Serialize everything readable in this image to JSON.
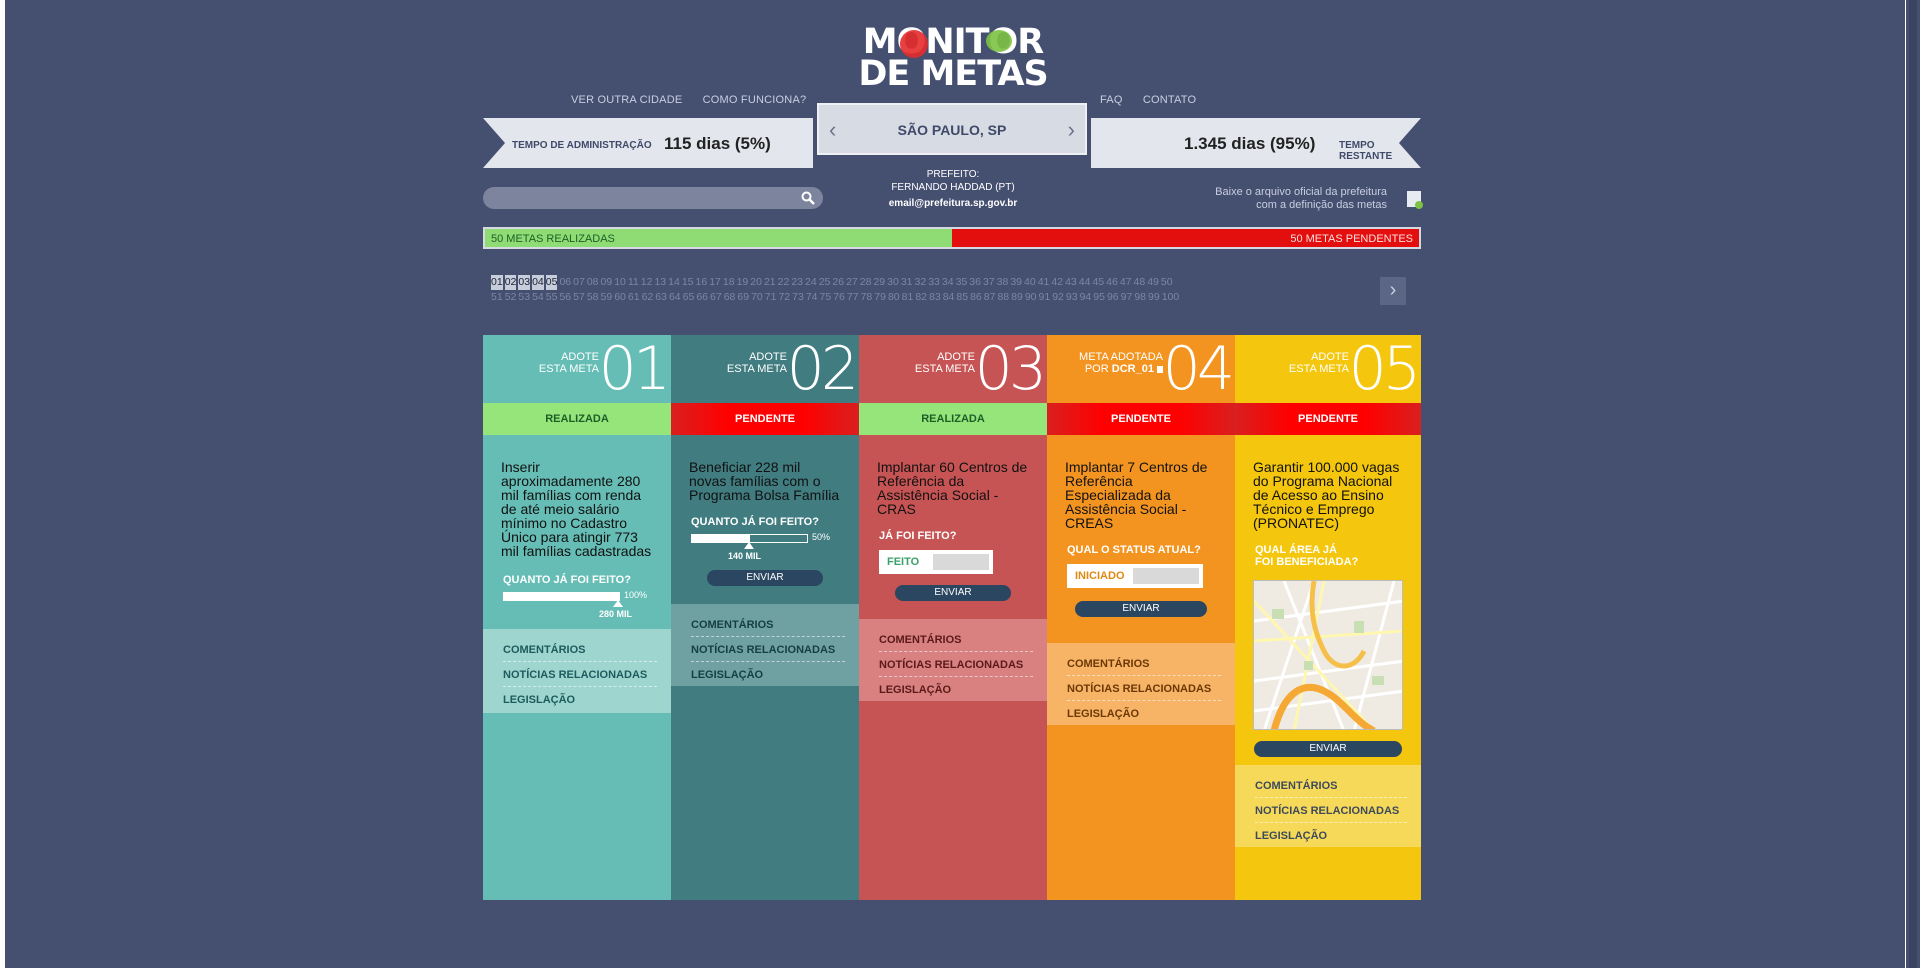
{
  "logo": {
    "line1": "MONITOR",
    "line2": "DE METAS"
  },
  "nav": {
    "left": [
      "VER OUTRA CIDADE",
      "COMO FUNCIONA?"
    ],
    "right": [
      "FAQ",
      "CONTATO"
    ]
  },
  "admin": {
    "label": "TEMPO DE ADMINISTRAÇÃO",
    "value": "115 dias (5%)"
  },
  "remaining": {
    "label": "TEMPO RESTANTE",
    "value": "1.345 dias (95%)"
  },
  "city": {
    "name": "SÃO PAULO, SP"
  },
  "mayor": {
    "label": "PREFEITO:",
    "name": "FERNANDO HADDAD (PT)",
    "email": "email@prefeitura.sp.gov.br"
  },
  "download": {
    "line1": "Baixe o arquivo oficial da prefeitura",
    "line2": "com a definição das metas"
  },
  "progress": {
    "done_label": "50 METAS REALIZADAS",
    "pending_label": "50 METAS PENDENTES",
    "done_fraction": 0.5
  },
  "numbers": {
    "row1": [
      "01",
      "02",
      "03",
      "04",
      "05",
      "06",
      "07",
      "08",
      "09",
      "10",
      "11",
      "12",
      "13",
      "14",
      "15",
      "16",
      "17",
      "18",
      "19",
      "20",
      "21",
      "22",
      "23",
      "24",
      "25",
      "26",
      "27",
      "28",
      "29",
      "30",
      "31",
      "32",
      "33",
      "34",
      "35",
      "36",
      "37",
      "38",
      "39",
      "40",
      "41",
      "42",
      "43",
      "44",
      "45",
      "46",
      "47",
      "48",
      "49",
      "50"
    ],
    "row2": [
      "51",
      "52",
      "53",
      "54",
      "55",
      "56",
      "57",
      "58",
      "59",
      "60",
      "61",
      "62",
      "63",
      "64",
      "65",
      "66",
      "67",
      "68",
      "69",
      "70",
      "71",
      "72",
      "73",
      "74",
      "75",
      "76",
      "77",
      "78",
      "79",
      "80",
      "81",
      "82",
      "83",
      "84",
      "85",
      "86",
      "87",
      "88",
      "89",
      "90",
      "91",
      "92",
      "93",
      "94",
      "95",
      "96",
      "97",
      "98",
      "99",
      "100"
    ],
    "active": [
      "01",
      "02",
      "03",
      "04",
      "05"
    ]
  },
  "cards": [
    {
      "adopt1": "ADOTE",
      "adopt2": "ESTA META",
      "num": "01",
      "status": "REALIZADA",
      "desc": "Inserir aproximadamente 280 mil famílias com renda de até meio salário mínimo no Cadastro Único para atingir 773 mil famílias cadastradas",
      "question": "QUANTO JÁ FOI FEITO?",
      "pct": "100%",
      "progress": 1.0,
      "amount": "280 MIL",
      "links": [
        "COMENTÁRIOS",
        "NOTÍCIAS RELACIONADAS",
        "LEGISLAÇÃO"
      ]
    },
    {
      "adopt1": "ADOTE",
      "adopt2": "ESTA META",
      "num": "02",
      "status": "PENDENTE",
      "desc": "Beneficiar 228 mil novas famílias com o Programa Bolsa Família",
      "question": "QUANTO JÁ FOI FEITO?",
      "pct": "50%",
      "progress": 0.5,
      "amount": "140 MIL",
      "send": "ENVIAR",
      "links": [
        "COMENTÁRIOS",
        "NOTÍCIAS RELACIONADAS",
        "LEGISLAÇÃO"
      ]
    },
    {
      "adopt1": "ADOTE",
      "adopt2": "ESTA META",
      "num": "03",
      "status": "REALIZADA",
      "desc": "Implantar 60 Centros de Referência da Assistência Social - CRAS",
      "question": "JÁ FOI FEITO?",
      "toggle": "FEITO",
      "send": "ENVIAR",
      "links": [
        "COMENTÁRIOS",
        "NOTÍCIAS RELACIONADAS",
        "LEGISLAÇÃO"
      ]
    },
    {
      "adopt1": "META ADOTADA",
      "adopt2": "POR",
      "adopter": "DCR_01",
      "num": "04",
      "status": "PENDENTE",
      "desc": "Implantar 7 Centros de Referência Especializada da Assistência Social - CREAS",
      "question": "QUAL O STATUS ATUAL?",
      "toggle": "INICIADO",
      "send": "ENVIAR",
      "links": [
        "COMENTÁRIOS",
        "NOTÍCIAS RELACIONADAS",
        "LEGISLAÇÃO"
      ]
    },
    {
      "adopt1": "ADOTE",
      "adopt2": "ESTA META",
      "num": "05",
      "status": "PENDENTE",
      "desc": "Garantir 100.000 vagas do Programa Nacional de Acesso ao Ensino Técnico e Emprego (PRONATEC)",
      "question1": "QUAL ÁREA JÁ",
      "question2": "FOI BENEFICIADA?",
      "send": "ENVIAR",
      "links": [
        "COMENTÁRIOS",
        "NOTÍCIAS RELACIONADAS",
        "LEGISLAÇÃO"
      ]
    }
  ],
  "colors": {
    "background": "#454f70",
    "done": "#96e57b",
    "pending": "#ff0000",
    "card1": "#66bdb5",
    "card2": "#407c80",
    "card3": "#c75454",
    "card4": "#f39421",
    "card5": "#f4c70e"
  },
  "icons": [
    "search-icon",
    "chevron-left-icon",
    "chevron-right-icon",
    "download-file-icon",
    "flag-icon",
    "map-image"
  ]
}
